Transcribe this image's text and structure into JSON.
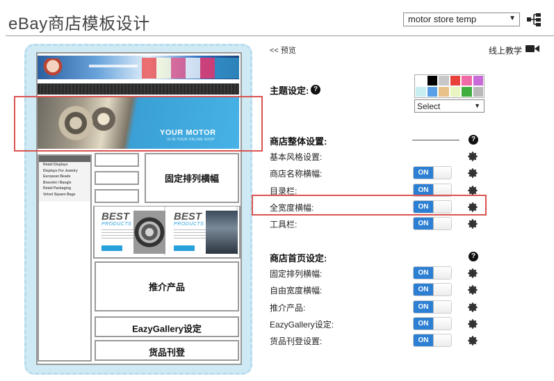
{
  "app": {
    "title": "eBay商店模板设计"
  },
  "template_selector": {
    "value": "motor store temp"
  },
  "preview": {
    "back_link": "<< 预览",
    "tutorial_link": "线上教学",
    "motor_banner": {
      "title": "YOUR MOTOR",
      "subtitle": "IS IN YOUR ONLINE SHOP"
    },
    "sidebar_items": [
      "Retail Displays",
      "Displays For Jewelry",
      "European Beads",
      "Bracelet / Bangle",
      "Retail Packaging",
      "Velvet Square Bags"
    ],
    "blocks": {
      "fixed_banner": "固定排列横幅",
      "recommended": "推介产品",
      "gallery": "EazyGallery设定",
      "listing": "货品刊登"
    },
    "best_products": [
      {
        "title": "BEST",
        "subtitle": "PRODUCTS"
      },
      {
        "title": "BEST",
        "subtitle": "PRODUCTS"
      }
    ]
  },
  "theme": {
    "label": "主题设定:",
    "swatch_colors": [
      "#ffffff",
      "#000000",
      "#c8c8c8",
      "#e8403a",
      "#f06aa8",
      "#c86ad8",
      "#c8eef2",
      "#5aa0e6",
      "#e8c18a",
      "#e8f5c0",
      "#3fae3f",
      "#b8b8b8"
    ],
    "select_value": "Select"
  },
  "store_settings": {
    "title": "商店整体设置:",
    "rows": [
      {
        "label": "基本风格设置:",
        "toggle": false
      },
      {
        "label": "商店名称横幅:",
        "toggle": true,
        "state": "ON"
      },
      {
        "label": "目录栏:",
        "toggle": true,
        "state": "ON"
      },
      {
        "label": "全宽度横幅:",
        "toggle": true,
        "state": "ON"
      },
      {
        "label": "工具栏:",
        "toggle": true,
        "state": "ON"
      }
    ]
  },
  "home_settings": {
    "title": "商店首页设定:",
    "rows": [
      {
        "label": "固定排列横幅:",
        "state": "ON"
      },
      {
        "label": "自由宽度横幅:",
        "state": "ON"
      },
      {
        "label": "推介产品:",
        "state": "ON"
      },
      {
        "label": "EazyGallery设定:",
        "state": "ON"
      },
      {
        "label": "货品刊登设置:",
        "state": "ON"
      }
    ]
  },
  "help_symbol": "?"
}
